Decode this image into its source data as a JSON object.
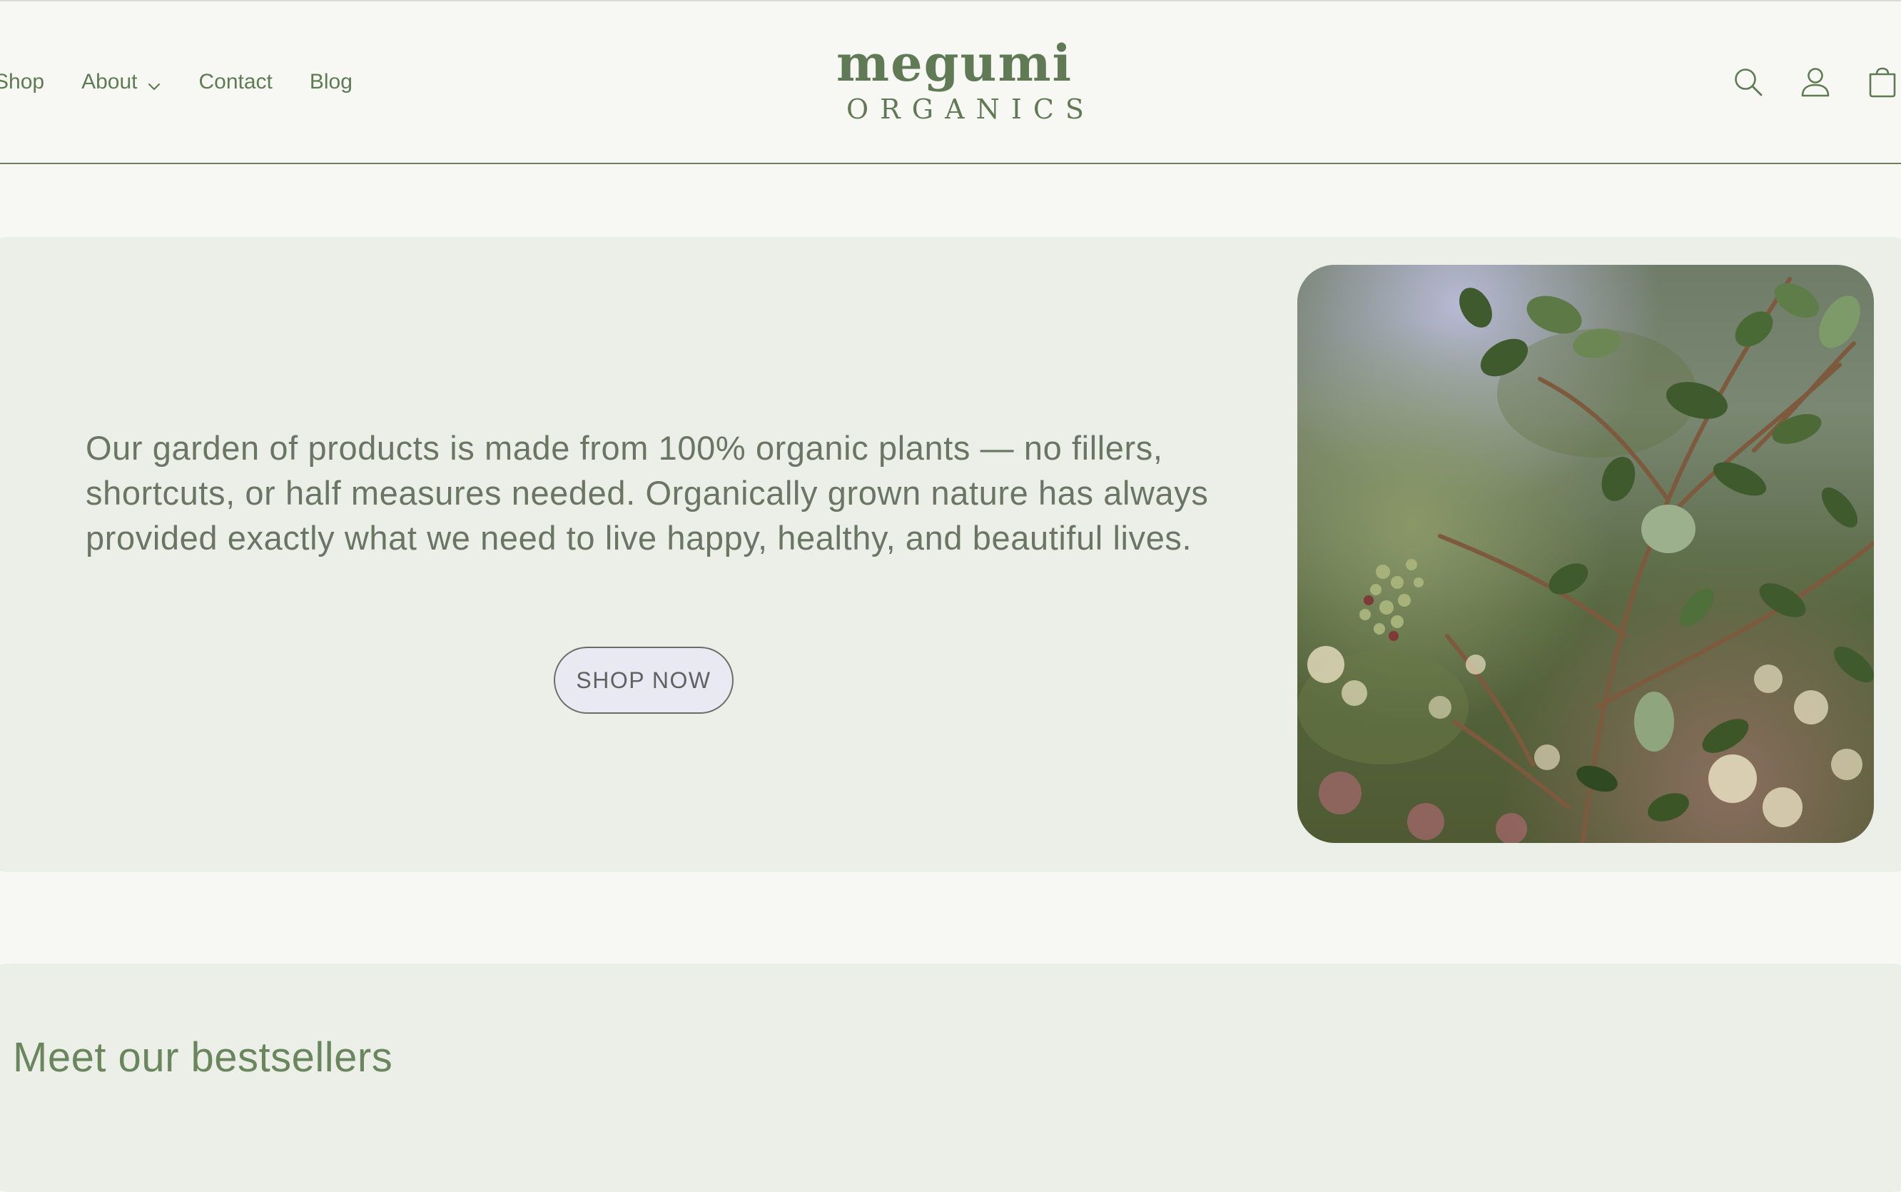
{
  "header": {
    "nav": [
      {
        "label": "Shop",
        "has_dropdown": false
      },
      {
        "label": "About",
        "has_dropdown": true
      },
      {
        "label": "Contact",
        "has_dropdown": false
      },
      {
        "label": "Blog",
        "has_dropdown": false
      }
    ],
    "logo": {
      "main": "megumi",
      "sub": "ORGANICS"
    },
    "icons": [
      "search-icon",
      "account-icon",
      "cart-icon"
    ]
  },
  "hero": {
    "text": "Our garden of products is made from 100% organic plants — no fillers, shortcuts, or half measures needed. Organically grown nature has always provided exactly what we need to live happy, healthy, and beautiful lives.",
    "button_label": "SHOP NOW"
  },
  "bestsellers": {
    "title": "Meet our bestsellers"
  },
  "colors": {
    "page_background": "#f7f8f3",
    "panel_background": "#ebefe8",
    "brand_green": "#617a56",
    "button_fill": "#e8e9f3"
  }
}
